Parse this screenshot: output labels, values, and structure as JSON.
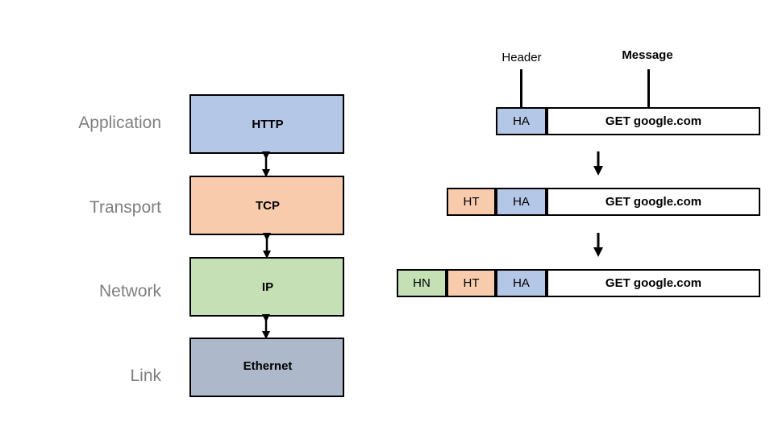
{
  "layers": [
    {
      "label": "Application",
      "protocol": "HTTP",
      "color": "#b4c7e7"
    },
    {
      "label": "Transport",
      "protocol": "TCP",
      "color": "#f8cbad"
    },
    {
      "label": "Network",
      "protocol": "IP",
      "color": "#c5e0b4"
    },
    {
      "label": "Link",
      "protocol": "Ethernet",
      "color": "#adb9ca"
    }
  ],
  "column_labels": {
    "header": "Header",
    "message": "Message"
  },
  "packets": [
    {
      "headers": [
        "HA"
      ],
      "message": "GET google.com"
    },
    {
      "headers": [
        "HT",
        "HA"
      ],
      "message": "GET google.com"
    },
    {
      "headers": [
        "HN",
        "HT",
        "HA"
      ],
      "message": "GET google.com"
    }
  ],
  "header_colors": {
    "HA": "#b4c7e7",
    "HT": "#f8cbad",
    "HN": "#c5e0b4"
  }
}
